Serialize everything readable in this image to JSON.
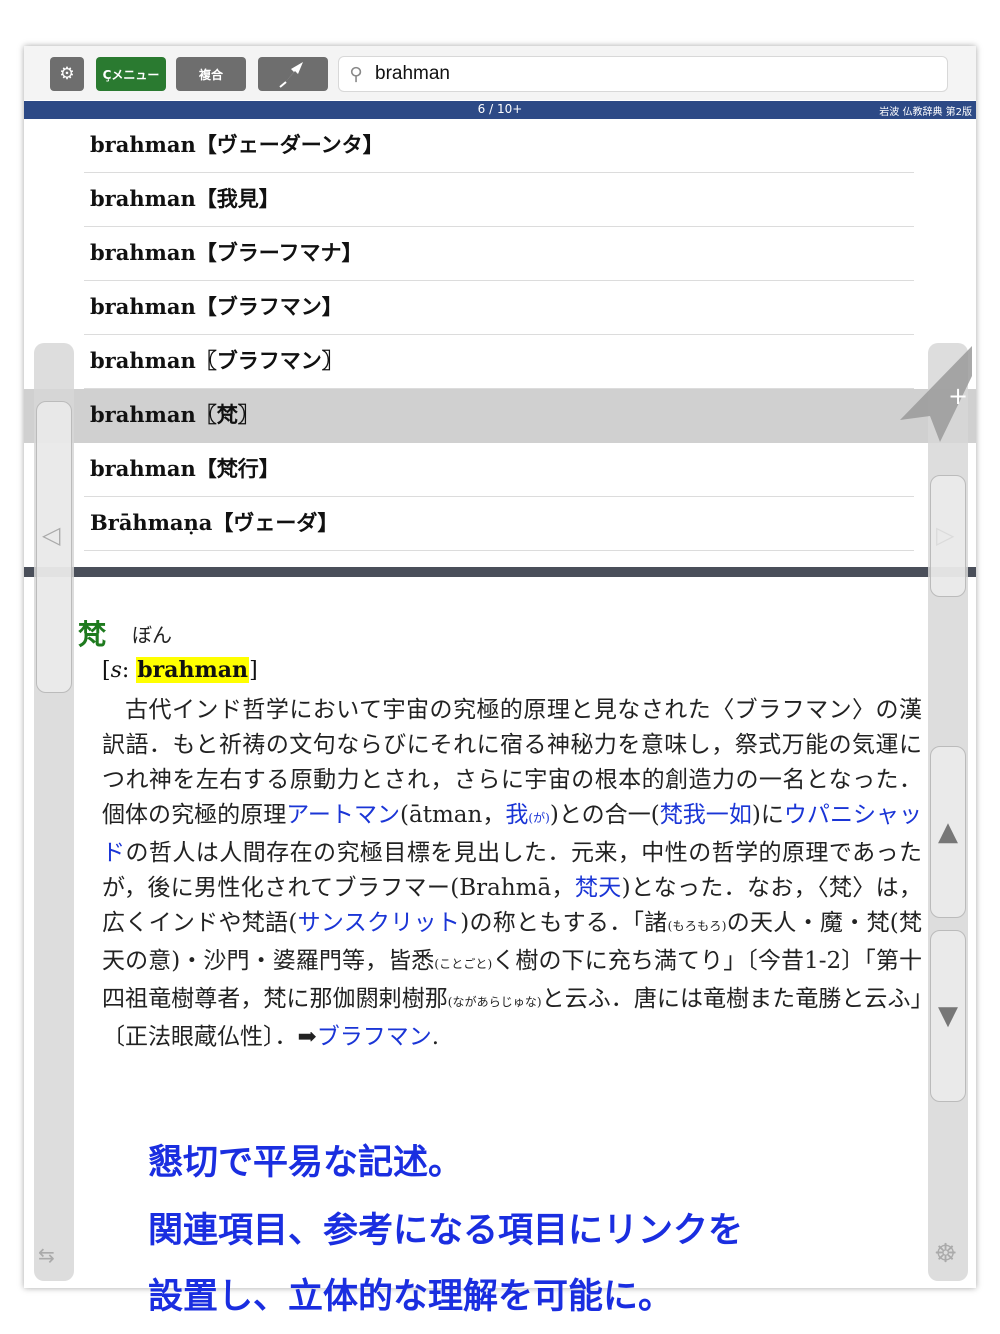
{
  "toolbar": {
    "menu_label": "Çメニュー",
    "compound_label": "複合",
    "search_value": "brahman"
  },
  "status": {
    "page_count": "6 / 10+",
    "dictionary": "岩波 仏教辞典 第2版"
  },
  "results": [
    "brahman【ヴェーダーンタ】",
    "brahman【我見】",
    "brahman【ブラーフマナ】",
    "brahman【ブラフマン】",
    "brahman〖ブラフマン〗",
    "brahman〖梵〗",
    "brahman【梵行】",
    "Brāhmaṇa【ヴェーダ】"
  ],
  "entry": {
    "headword": "梵",
    "reading": "ぼん",
    "sanskrit_open": "[",
    "sanskrit_prefix": "s",
    "sanskrit_colon": ": ",
    "sanskrit_term": "brahman",
    "sanskrit_close": "]",
    "t1": "古代インド哲学において宇宙の究極的原理と見なされた〈ブラフマン〉の漢訳語．もと祈祷の文句ならびにそれに宿る神秘力を意味し，祭式万能の気運につれ神を左右する原動力とされ，さらに宇宙の根本的創造力の一名となった．個体の究極的原理",
    "l1": "アートマン",
    "t2": "(ātman，",
    "l2": "我",
    "r2": "(が)",
    "t3": ")との合一(",
    "l3": "梵我一如",
    "t4": ")に",
    "l4": "ウパニシャッド",
    "t5": "の哲人は人間存在の究極目標を見出した．元来，中性の哲学的原理であったが，後に男性化されてブラフマー(Brahmā，",
    "l5": "梵天",
    "t6": ")となった．なお，〈梵〉は，広くインドや梵語(",
    "l6": "サンスクリット",
    "t7": ")の称ともする．「諸",
    "r7": "(もろもろ)",
    "t8": "の天人・魔・梵(梵天の意)・沙門・婆羅門等，皆悉",
    "r8": "(ことごと)",
    "t9": "く樹の下に充ち満てり」〔今昔1-2〕「第十四祖竜樹尊者，梵に那伽閼剌樹那",
    "r9": "(ながあらじゅな)",
    "t10": "と云ふ．唐には竜樹また竜勝と云ふ」〔正法眼蔵仏性〕．➡",
    "l10": "ブラフマン",
    "t11": "."
  },
  "captions": [
    "懇切で平易な記述。",
    "関連項目、参考になる項目にリンクを",
    "設置し、立体的な理解を可能に。"
  ],
  "icons": {
    "settings": "gear-icon",
    "pin": "pin-icon",
    "search": "search-icon",
    "bookmark_add": "plus-icon",
    "prev": "left-triangle-icon",
    "next": "right-triangle-icon",
    "scroll_up": "up-triangle-icon",
    "scroll_down": "down-triangle-icon",
    "swap": "swap-arrows-icon",
    "helm": "ship-wheel-icon"
  },
  "colors": {
    "menu_green": "#2a7a30",
    "status_blue": "#2d4a86",
    "headword_green": "#1e7a1e",
    "link_blue": "#1a35d6",
    "highlight": "#ffff00",
    "caption_blue": "#1a2ee0"
  }
}
